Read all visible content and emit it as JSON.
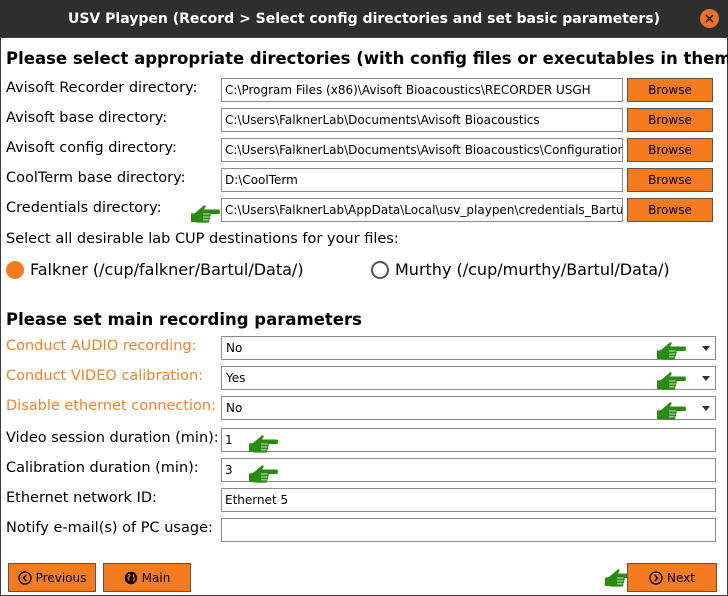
{
  "window": {
    "title": "USV Playpen (Record > Select config directories and set basic parameters)"
  },
  "directories": {
    "heading": "Please select appropriate directories (with config files or executables in them)",
    "rows": [
      {
        "label": "Avisoft Recorder directory:",
        "value": "C:\\Program Files (x86)\\Avisoft Bioacoustics\\RECORDER USGH",
        "button": "Browse"
      },
      {
        "label": "Avisoft base directory:",
        "value": "C:\\Users\\FalknerLab\\Documents\\Avisoft Bioacoustics",
        "button": "Browse"
      },
      {
        "label": "Avisoft config directory:",
        "value": "C:\\Users\\FalknerLab\\Documents\\Avisoft Bioacoustics\\Configurations\\RECORDER_USGH",
        "button": "Browse"
      },
      {
        "label": "CoolTerm base directory:",
        "value": "D:\\CoolTerm",
        "button": "Browse"
      },
      {
        "label": "Credentials directory:",
        "value": "C:\\Users\\FalknerLab\\AppData\\Local\\usv_playpen\\credentials_Bartul",
        "button": "Browse"
      }
    ]
  },
  "destinations": {
    "prompt": "Select all desirable lab CUP destinations for your files:",
    "options": [
      {
        "label": "Falkner (/cup/falkner/Bartul/Data/)",
        "checked": true
      },
      {
        "label": "Murthy (/cup/murthy/Bartul/Data/)",
        "checked": false
      }
    ]
  },
  "recording": {
    "heading": "Please set main recording parameters",
    "dropdowns": [
      {
        "label": "Conduct AUDIO recording:",
        "value": "No"
      },
      {
        "label": "Conduct VIDEO calibration:",
        "value": "Yes"
      },
      {
        "label": "Disable ethernet connection:",
        "value": "No"
      }
    ],
    "fields": [
      {
        "label": "Video session duration (min):",
        "value": "1"
      },
      {
        "label": "Calibration duration (min):",
        "value": "3"
      },
      {
        "label": "Ethernet network ID:",
        "value": "Ethernet 5"
      },
      {
        "label": "Notify e-mail(s) of PC usage:",
        "value": ""
      }
    ]
  },
  "nav": {
    "previous": "Previous",
    "main": "Main",
    "next": "Next"
  },
  "colors": {
    "accent": "#f47b20",
    "label_orange": "#f0822f",
    "hand": "#2a8a14",
    "titlebar": "#2e2e2e"
  }
}
